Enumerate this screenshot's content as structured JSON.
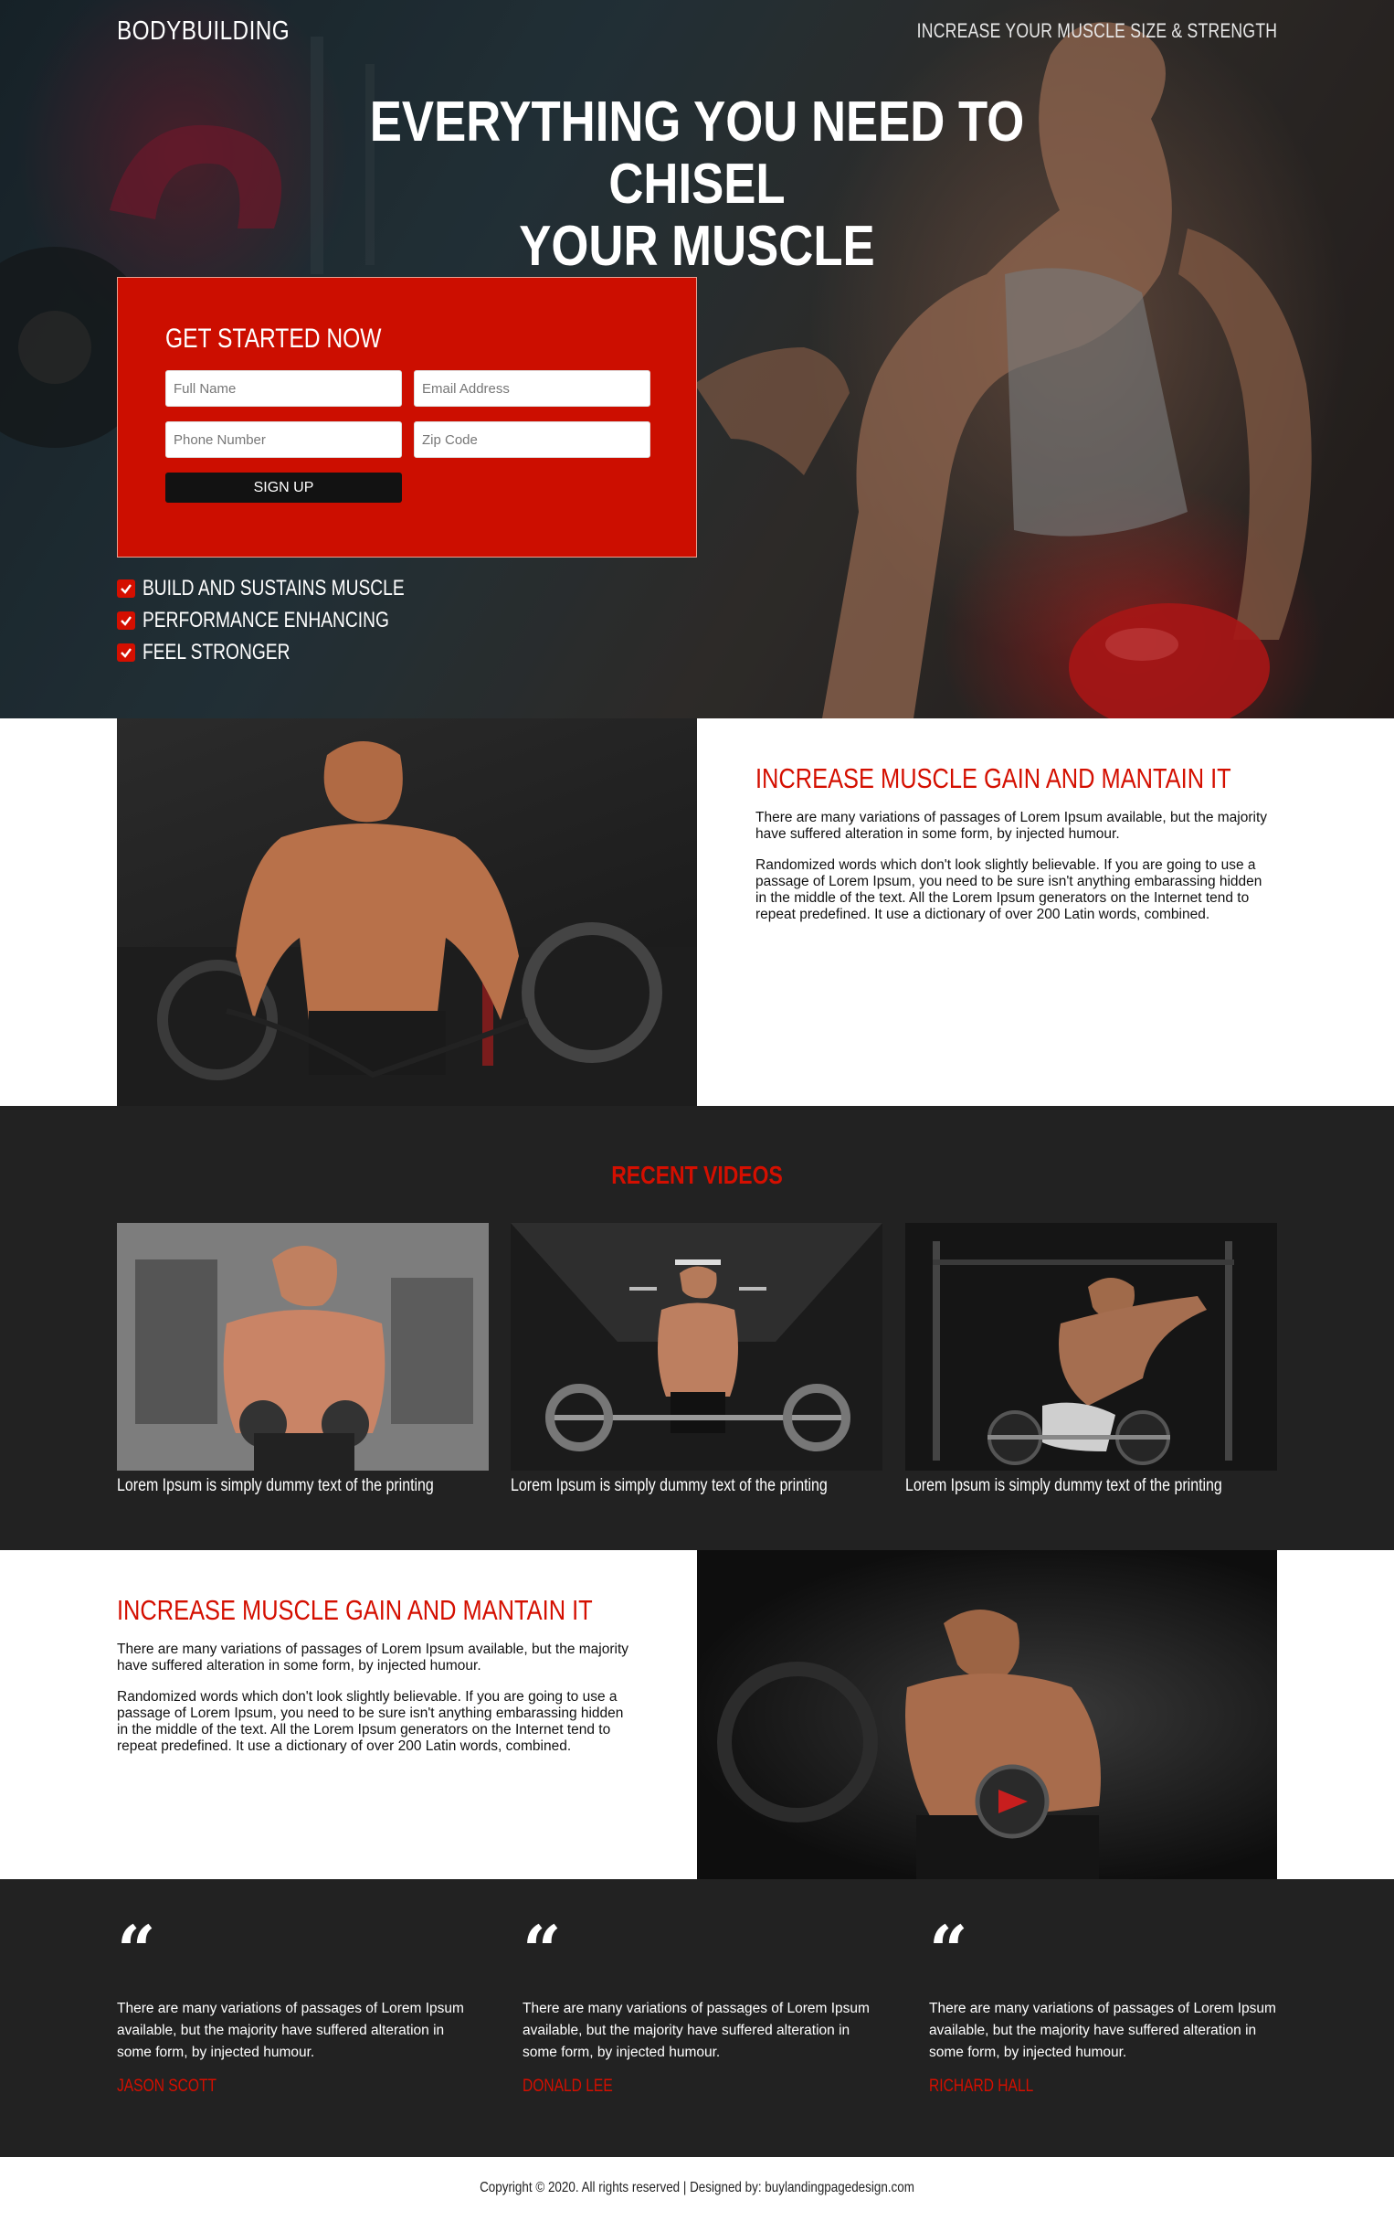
{
  "header": {
    "brand": "BODYBUILDING",
    "tagline": "INCREASE YOUR MUSCLE SIZE & STRENGTH"
  },
  "hero": {
    "headline_line1": "EVERYTHING YOU NEED TO CHISEL",
    "headline_line2": "YOUR MUSCLE"
  },
  "form": {
    "title": "GET STARTED NOW",
    "full_name_placeholder": "Full Name",
    "email_placeholder": "Email Address",
    "phone_placeholder": "Phone Number",
    "zip_placeholder": "Zip Code",
    "submit_label": "SIGN UP"
  },
  "features": [
    "BUILD AND SUSTAINS MUSCLE",
    "PERFORMANCE ENHANCING",
    "FEEL STRONGER"
  ],
  "section_one": {
    "title": "INCREASE MUSCLE GAIN AND MANTAIN IT",
    "para1": "There are many variations of passages of Lorem Ipsum available, but the majority have suffered alteration in some form, by injected humour.",
    "para2": "Randomized words which don't look slightly believable. If you are going to use a passage of Lorem Ipsum, you need to be sure isn't anything embarassing hidden in the middle of the text. All the Lorem Ipsum generators on the Internet tend to repeat predefined. It use a dictionary of over 200 Latin words, combined."
  },
  "videos": {
    "title": "RECENT VIDEOS",
    "items": [
      {
        "caption": "Lorem Ipsum is simply dummy text of the printing"
      },
      {
        "caption": "Lorem Ipsum is simply dummy text of the printing"
      },
      {
        "caption": "Lorem Ipsum is simply dummy text of the printing"
      }
    ]
  },
  "section_two": {
    "title": "INCREASE MUSCLE GAIN AND MANTAIN IT",
    "para1": "There are many variations of passages of Lorem Ipsum available, but the majority have suffered alteration in some form, by injected humour.",
    "para2": "Randomized words which don't look slightly believable. If you are going to use a passage of Lorem Ipsum, you need to be sure isn't anything embarassing hidden in the middle of the text. All the Lorem Ipsum generators on the Internet tend to repeat predefined. It use a dictionary of over 200 Latin words, combined."
  },
  "testimonials": [
    {
      "quote_mark": "“",
      "text": "There are many variations of passages of Lorem Ipsum available, but the majority have suffered alteration in some form, by injected humour.",
      "name": "JASON SCOTT"
    },
    {
      "quote_mark": "“",
      "text": "There are many variations of passages of Lorem Ipsum available, but the majority have suffered alteration in some form, by injected humour.",
      "name": "DONALD LEE"
    },
    {
      "quote_mark": "“",
      "text": "There are many variations of passages of Lorem Ipsum available, but the majority have suffered alteration in some form, by injected humour.",
      "name": "RICHARD HALL"
    }
  ],
  "footer": {
    "text": "Copyright © 2020. All rights reserved | Designed by: buylandingpagedesign.com"
  },
  "colors": {
    "accent_red": "#d40f00",
    "form_red": "#cc0e00",
    "dark_bg": "#222222",
    "button_dark": "#121212"
  }
}
